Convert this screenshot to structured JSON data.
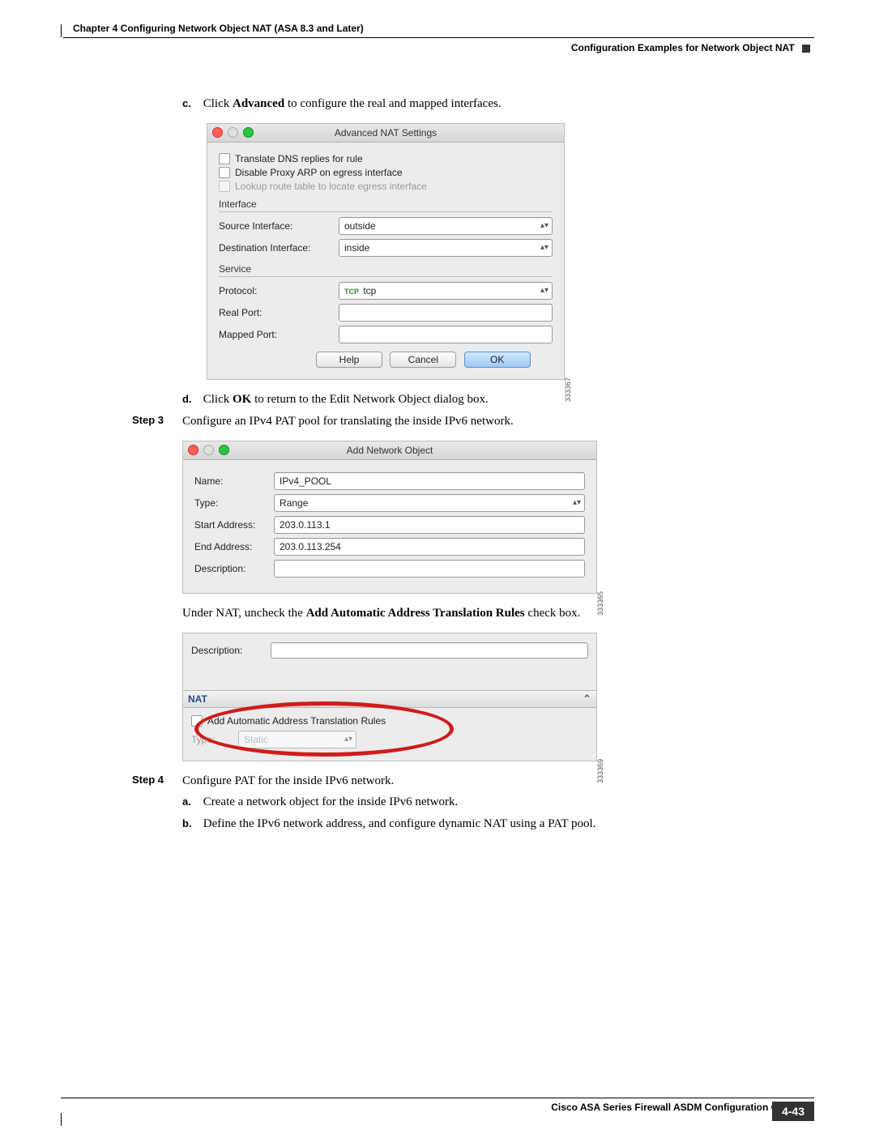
{
  "header": {
    "chapter": "Chapter 4    Configuring Network Object NAT (ASA 8.3 and Later)",
    "section": "Configuration Examples for Network Object NAT"
  },
  "body": {
    "c_prefix": "c.",
    "c_text1": "Click ",
    "c_bold": "Advanced",
    "c_text2": " to configure the real and mapped interfaces.",
    "d_prefix": "d.",
    "d_text1": "Click ",
    "d_bold": "OK",
    "d_text2": " to return to the Edit Network Object dialog box.",
    "step3_label": "Step 3",
    "step3_text": "Configure an IPv4 PAT pool for translating the inside IPv6 network.",
    "under_nat_1": "Under NAT, uncheck the ",
    "under_nat_bold": "Add Automatic Address Translation Rules",
    "under_nat_2": " check box.",
    "step4_label": "Step 4",
    "step4_text": "Configure PAT for the inside IPv6 network.",
    "a_prefix": "a.",
    "a_text": "Create a network object for the inside IPv6 network.",
    "b_prefix": "b.",
    "b_text": "Define the IPv6 network address, and configure dynamic NAT using a PAT pool."
  },
  "adv_nat": {
    "title": "Advanced NAT Settings",
    "chk1": "Translate DNS replies for rule",
    "chk2": "Disable Proxy ARP on egress interface",
    "chk3": "Lookup route table to locate egress interface",
    "fs1": "Interface",
    "src_label": "Source Interface:",
    "src_val": "outside",
    "dst_label": "Destination Interface:",
    "dst_val": "inside",
    "fs2": "Service",
    "proto_label": "Protocol:",
    "proto_val": "tcp",
    "real_label": "Real Port:",
    "mapped_label": "Mapped Port:",
    "btn_help": "Help",
    "btn_cancel": "Cancel",
    "btn_ok": "OK",
    "sideid": "333367"
  },
  "add_obj": {
    "title": "Add Network Object",
    "name_label": "Name:",
    "name_val": "IPv4_POOL",
    "type_label": "Type:",
    "type_val": "Range",
    "start_label": "Start Address:",
    "start_val": "203.0.113.1",
    "end_label": "End Address:",
    "end_val": "203.0.113.254",
    "desc_label": "Description:",
    "sideid": "333365"
  },
  "nat_panel": {
    "desc_label": "Description:",
    "group": "NAT",
    "chk": "Add Automatic Address Translation Rules",
    "type_label": "Type:",
    "type_val": "Static",
    "sideid": "333369"
  },
  "footer": {
    "guide": "Cisco ASA Series Firewall ASDM Configuration Guide",
    "page": "4-43"
  }
}
